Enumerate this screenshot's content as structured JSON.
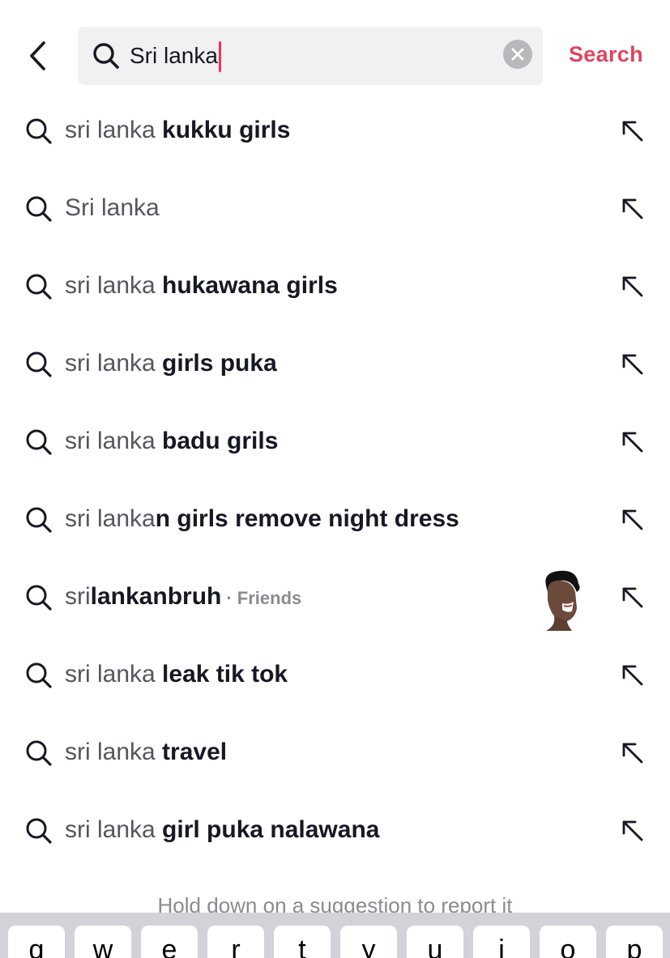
{
  "header": {
    "back_icon": "chevron-left-icon",
    "search_value": "Sri lanka",
    "clear_icon": "clear-x-icon",
    "search_label": "Search"
  },
  "suggestions": [
    {
      "prefix": "sri lanka ",
      "bold": "kukku girls",
      "tag": ""
    },
    {
      "prefix": "Sri lanka",
      "bold": "",
      "tag": ""
    },
    {
      "prefix": "sri lanka ",
      "bold": "hukawana girls",
      "tag": ""
    },
    {
      "prefix": "sri lanka ",
      "bold": "girls puka",
      "tag": ""
    },
    {
      "prefix": "sri lanka ",
      "bold": "badu grils",
      "tag": ""
    },
    {
      "prefix": "sri lanka",
      "bold": "n girls remove night dress",
      "tag": ""
    },
    {
      "prefix": "sri",
      "bold": "lankanbruh",
      "tag": "· Friends"
    },
    {
      "prefix": "sri lanka ",
      "bold": "leak tik tok",
      "tag": ""
    },
    {
      "prefix": "sri lanka ",
      "bold": "travel",
      "tag": ""
    },
    {
      "prefix": "sri lanka ",
      "bold": "girl puka nalawana",
      "tag": ""
    }
  ],
  "hint": "Hold down on a suggestion to report it",
  "keyboard": {
    "keys": [
      "q",
      "w",
      "e",
      "r",
      "t",
      "y",
      "u",
      "i",
      "o",
      "p"
    ]
  },
  "colors": {
    "accent": "#e0455d",
    "caret": "#fe2c55",
    "search_bg": "#f1f1f2"
  }
}
